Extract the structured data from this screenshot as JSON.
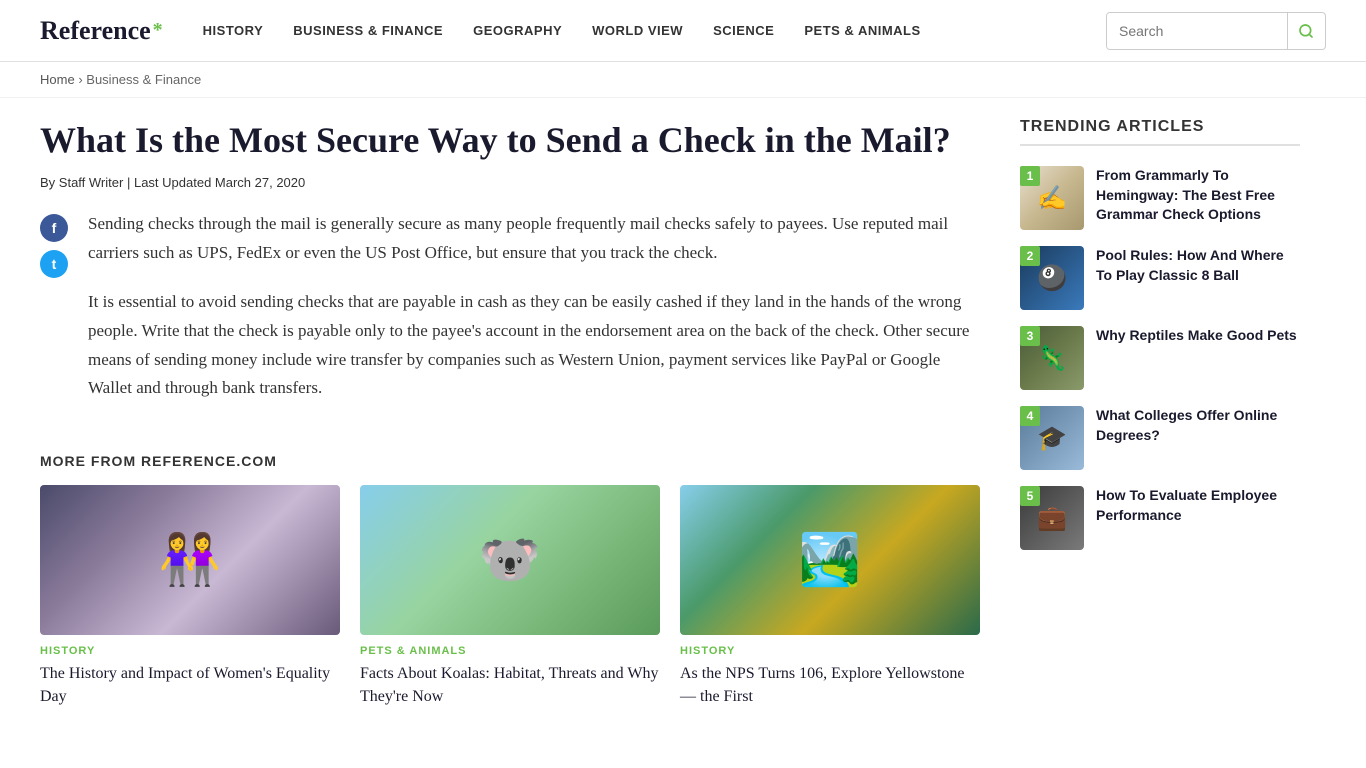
{
  "header": {
    "logo_text": "Reference",
    "logo_asterisk": "*",
    "nav_items": [
      {
        "label": "HISTORY",
        "id": "history"
      },
      {
        "label": "BUSINESS & FINANCE",
        "id": "business-finance"
      },
      {
        "label": "GEOGRAPHY",
        "id": "geography"
      },
      {
        "label": "WORLD VIEW",
        "id": "world-view"
      },
      {
        "label": "SCIENCE",
        "id": "science"
      },
      {
        "label": "PETS & ANIMALS",
        "id": "pets-animals"
      }
    ],
    "search_placeholder": "Search"
  },
  "breadcrumb": {
    "home": "Home",
    "separator": "›",
    "current": "Business & Finance"
  },
  "article": {
    "title": "What Is the Most Secure Way to Send a Check in the Mail?",
    "byline": "By Staff Writer",
    "separator": "|",
    "updated_label": "Last Updated March 27, 2020",
    "paragraph1": "Sending checks through the mail is generally secure as many people frequently mail checks safely to payees. Use reputed mail carriers such as UPS, FedEx or even the US Post Office, but ensure that you track the check.",
    "paragraph2": "It is essential to avoid sending checks that are payable in cash as they can be easily cashed if they land in the hands of the wrong people. Write that the check is payable only to the payee's account in the endorsement area on the back of the check. Other secure means of sending money include wire transfer by companies such as Western Union, payment services like PayPal or Google Wallet and through bank transfers.",
    "more_from_label": "MORE FROM REFERENCE.COM"
  },
  "cards": [
    {
      "id": "card-women",
      "category": "HISTORY",
      "category_class": "cat-history",
      "title": "The History and Impact of Women's Equality Day",
      "img_class": "card-img-women"
    },
    {
      "id": "card-koala",
      "category": "PETS & ANIMALS",
      "category_class": "cat-pets",
      "title": "Facts About Koalas: Habitat, Threats and Why They're Now",
      "img_class": "card-img-koala"
    },
    {
      "id": "card-yellowstone",
      "category": "HISTORY",
      "category_class": "cat-history",
      "title": "As the NPS Turns 106, Explore Yellowstone — the First",
      "img_class": "card-img-yellowstone"
    }
  ],
  "sidebar": {
    "trending_label": "TRENDING ARTICLES",
    "items": [
      {
        "rank": "1",
        "title": "From Grammarly To Hemingway: The Best Free Grammar Check Options",
        "thumb_class": "thumb-grammar",
        "thumb_icon": "✍️"
      },
      {
        "rank": "2",
        "title": "Pool Rules: How And Where To Play Classic 8 Ball",
        "thumb_class": "thumb-pool",
        "thumb_icon": "🎱"
      },
      {
        "rank": "3",
        "title": "Why Reptiles Make Good Pets",
        "thumb_class": "thumb-reptile",
        "thumb_icon": "🦎"
      },
      {
        "rank": "4",
        "title": "What Colleges Offer Online Degrees?",
        "thumb_class": "thumb-college",
        "thumb_icon": "🎓"
      },
      {
        "rank": "5",
        "title": "How To Evaluate Employee Performance",
        "thumb_class": "thumb-employee",
        "thumb_icon": "💼"
      }
    ]
  },
  "social": {
    "facebook_label": "f",
    "twitter_label": "t"
  }
}
